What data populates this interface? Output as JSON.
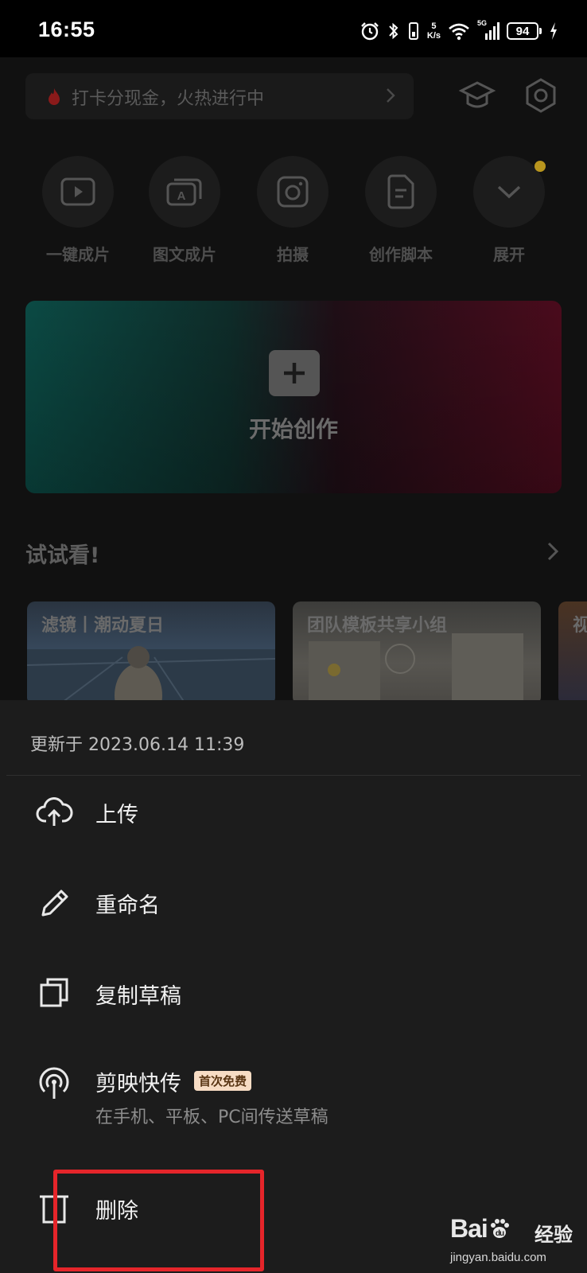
{
  "status_bar": {
    "time": "16:55",
    "net_speed_value": "5",
    "net_speed_unit": "K/s",
    "signal_label": "5G",
    "battery": "94",
    "icons": [
      "alarm-icon",
      "bluetooth-icon",
      "vibrate-icon",
      "wifi-icon",
      "cellular-signal-icon",
      "charging-icon"
    ]
  },
  "background_app": {
    "promo_text": "打卡分现金，火热进行中",
    "tools": [
      {
        "label": "一键成片",
        "icon": "play-video-icon"
      },
      {
        "label": "图文成片",
        "icon": "text-image-icon"
      },
      {
        "label": "拍摄",
        "icon": "camera-icon"
      },
      {
        "label": "创作脚本",
        "icon": "script-document-icon"
      },
      {
        "label": "展开",
        "icon": "chevron-down-icon"
      }
    ],
    "create_label": "开始创作",
    "section_title": "试试看!",
    "templates": [
      {
        "label": "滤镜丨潮动夏日"
      },
      {
        "label": "团队模板共享小组"
      },
      {
        "label": "视"
      }
    ]
  },
  "sheet": {
    "updated": "更新于 2023.06.14 11:39",
    "items": [
      {
        "label": "上传",
        "icon": "cloud-upload-icon"
      },
      {
        "label": "重命名",
        "icon": "pencil-icon"
      },
      {
        "label": "复制草稿",
        "icon": "copy-icon"
      },
      {
        "label": "剪映快传",
        "tag": "首次免费",
        "sub": "在手机、平板、PC间传送草稿",
        "icon": "broadcast-icon"
      },
      {
        "label": "删除",
        "icon": "trash-icon"
      }
    ]
  },
  "watermark": {
    "brand": "Bai",
    "brand_suffix": "du",
    "cn": "经验",
    "url": "jingyan.baidu.com"
  },
  "colors": {
    "highlight": "#e5252a",
    "sheet_bg": "#1c1c1c"
  }
}
